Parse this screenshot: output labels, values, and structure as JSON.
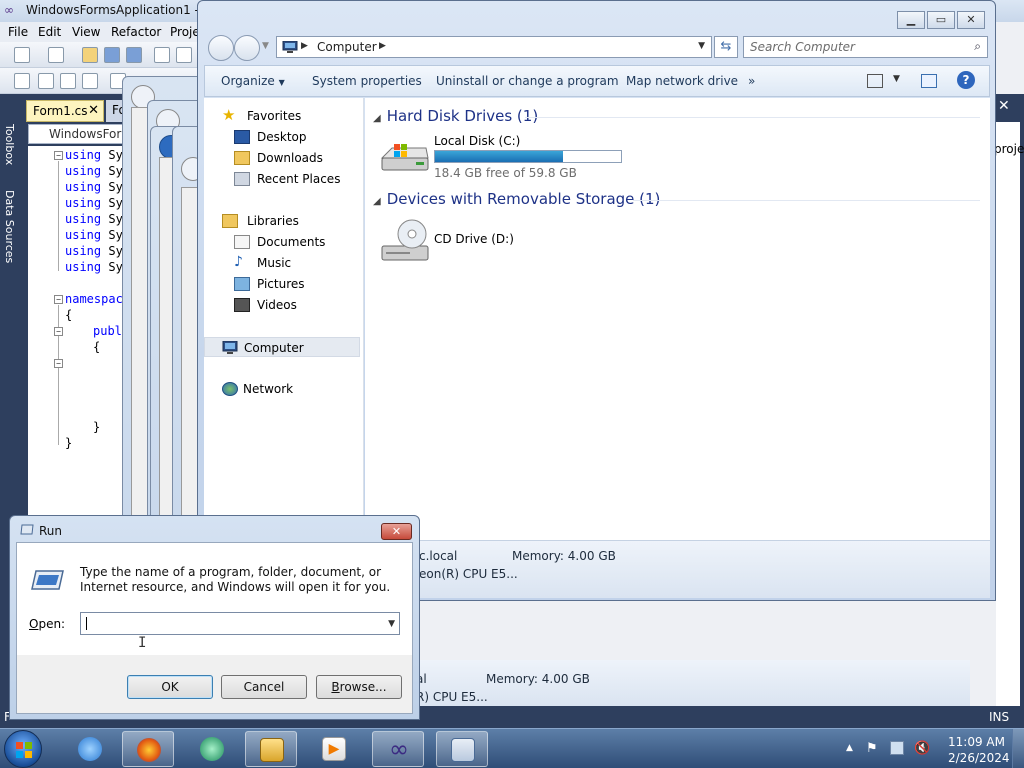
{
  "vs": {
    "title": "WindowsFormsApplication1 - M",
    "menu": [
      "File",
      "Edit",
      "View",
      "Refactor",
      "Proje"
    ],
    "side_labels": [
      "Toolbox",
      "Data Sources"
    ],
    "tabs": [
      "Form1.cs",
      "Fo"
    ],
    "combo": "WindowsForr",
    "code_lines": [
      "using Sy",
      "using Sy",
      "using Sy",
      "using Sy",
      "using Sy",
      "using Sy",
      "using Sy",
      "using Sy",
      "namespac",
      "{",
      "publ",
      "{",
      "}",
      "}"
    ],
    "right_panel_text": "proje",
    "status_left": "F",
    "status_ins": "INS"
  },
  "explorer": {
    "caption_buttons": [
      "minimize",
      "maximize",
      "close"
    ],
    "address": {
      "crumb": "Computer"
    },
    "search_placeholder": "Search Computer",
    "commands": [
      "Organize",
      "System properties",
      "Uninstall or change a program",
      "Map network drive",
      "»"
    ],
    "nav": {
      "favorites_header": "Favorites",
      "favorites": [
        "Desktop",
        "Downloads",
        "Recent Places"
      ],
      "libraries_header": "Libraries",
      "libraries": [
        "Documents",
        "Music",
        "Pictures",
        "Videos"
      ],
      "computer": "Computer",
      "network": "Network"
    },
    "groups": {
      "hdd": "Hard Disk Drives (1)",
      "removable": "Devices with Removable Storage (1)"
    },
    "drives": {
      "c_name": "Local Disk (C:)",
      "c_free": "18.4 GB free of 59.8 GB",
      "c_used_fraction": 0.69,
      "d_name": "CD Drive (D:)"
    },
    "details": {
      "domain": "c.local",
      "memory": "Memory: 4.00 GB",
      "cpu": "eon(R) CPU E5..."
    }
  },
  "bg_details": {
    "domain": "al",
    "memory": "Memory: 4.00 GB",
    "cpu": "R) CPU E5..."
  },
  "run": {
    "title": "Run",
    "close": "✕",
    "description": "Type the name of a program, folder, document, or Internet resource, and Windows will open it for you.",
    "open_label_u": "O",
    "open_label_rest": "pen:",
    "input_value": "",
    "ok": "OK",
    "cancel": "Cancel",
    "browse_u": "B",
    "browse_rest": "rowse..."
  },
  "taskbar": {
    "apps": [
      "internet-explorer",
      "firefox",
      "app-green",
      "windows-explorer",
      "media-player",
      "visual-studio",
      "run"
    ],
    "time": "11:09 AM",
    "date": "2/26/2024"
  },
  "colors": {
    "accent": "#1e3287",
    "progress": "#1a6fb3",
    "taskbar": "#2f4d77"
  }
}
